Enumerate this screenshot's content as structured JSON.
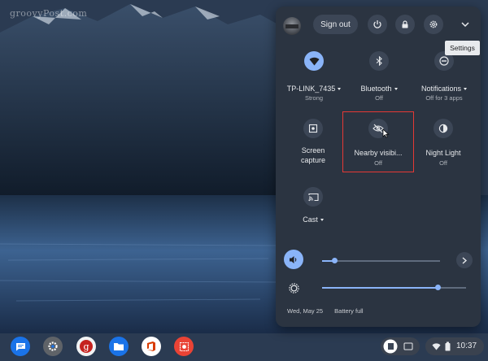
{
  "wallpaper": {
    "watermark": "groovyPost.com"
  },
  "header": {
    "sign_out_label": "Sign out",
    "settings_tooltip": "Settings"
  },
  "tiles": [
    {
      "key": "wifi",
      "label": "TP-LINK_7435",
      "sub": "Strong",
      "has_caret": true,
      "active": true,
      "icon": "wifi-icon"
    },
    {
      "key": "bluetooth",
      "label": "Bluetooth",
      "sub": "Off",
      "has_caret": true,
      "active": false,
      "icon": "bluetooth-icon"
    },
    {
      "key": "notifications",
      "label": "Notifications",
      "sub": "Off for 3 apps",
      "has_caret": true,
      "active": false,
      "icon": "do-not-disturb-icon"
    },
    {
      "key": "screen_capture",
      "label": "Screen",
      "label2": "capture",
      "active": false,
      "icon": "screen-capture-icon"
    },
    {
      "key": "nearby",
      "label": "Nearby visibi...",
      "sub": "Off",
      "active": false,
      "icon": "nearby-visibility-off-icon"
    },
    {
      "key": "night_light",
      "label": "Night Light",
      "sub": "Off",
      "active": false,
      "icon": "night-light-icon"
    },
    {
      "key": "cast",
      "label": "Cast",
      "has_caret": true,
      "active": false,
      "icon": "cast-icon"
    }
  ],
  "sliders": {
    "volume": {
      "level": 0.1,
      "icon": "volume-icon"
    },
    "brightness": {
      "level": 0.8,
      "icon": "brightness-icon"
    }
  },
  "footer": {
    "date": "Wed, May 25",
    "battery": "Battery full"
  },
  "shelf": {
    "apps": [
      "messages-icon",
      "settings-app-icon",
      "google-plus-icon",
      "files-icon",
      "office-icon",
      "screen-recorder-icon"
    ],
    "time": "10:37"
  },
  "colors": {
    "accent": "#8ab4f8",
    "panel": "#2b3441",
    "highlight": "#e53935"
  }
}
